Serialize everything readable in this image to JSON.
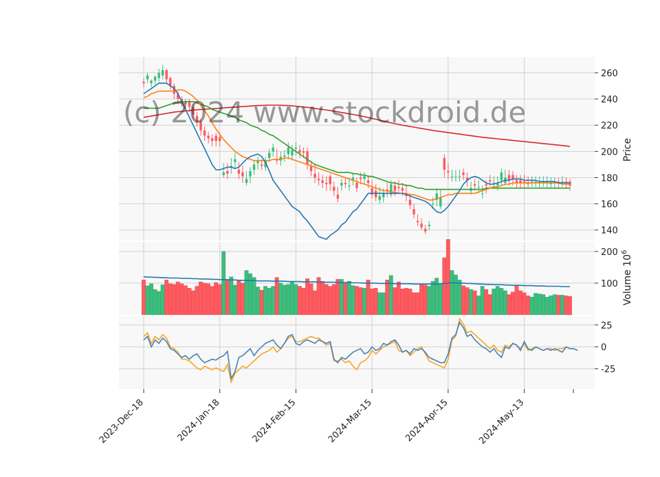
{
  "watermark": "(c) 2024 www.stockdroid.de",
  "colors": {
    "up": "#3dbd7d",
    "down": "#ff5a5f",
    "sma20": "#1f77b4",
    "sma50": "#ff7f0e",
    "sma100": "#2ca02c",
    "sma200": "#d62728",
    "vol_avg": "#1f77b4",
    "osc1": "#4682b4",
    "osc2": "#f5a623",
    "panel_bg": "#f8f8f8",
    "grid": "#d0d0d0"
  },
  "chart_data": [
    {
      "type": "candlestick",
      "ylabel": "Price",
      "ylim": [
        132,
        272
      ],
      "yticks": [
        140,
        160,
        180,
        200,
        220,
        240,
        260
      ],
      "x_tick_labels": [
        "2023-Dec-18",
        "2024-Jan-18",
        "2024-Feb-15",
        "2024-Mar-15",
        "2024-Apr-15",
        "2024-May-13"
      ],
      "x_tick_index": [
        0,
        20,
        40,
        60,
        80,
        100
      ],
      "open": [
        253,
        255,
        252,
        254,
        256,
        258,
        262,
        256,
        250,
        244,
        240,
        238,
        238,
        234,
        227,
        223,
        216,
        212,
        210,
        212,
        211,
        182,
        185,
        188,
        192,
        186,
        184,
        176,
        181,
        186,
        191,
        190,
        188,
        195,
        200,
        194,
        193,
        196,
        198,
        197,
        202,
        201,
        200,
        200,
        189,
        183,
        179,
        178,
        176,
        181,
        173,
        167,
        174,
        176,
        174,
        178,
        176,
        180,
        179,
        178,
        172,
        170,
        163,
        165,
        171,
        167,
        174,
        173,
        172,
        168,
        163,
        156,
        147,
        145,
        141,
        143,
        160,
        163,
        158,
        195,
        185,
        181,
        181,
        181,
        184,
        180,
        170,
        175,
        173,
        168,
        175,
        178,
        176,
        174,
        178,
        176,
        182,
        182,
        178,
        178,
        177,
        176,
        177,
        177,
        176,
        177,
        176,
        175,
        176,
        177,
        176,
        177,
        177
      ],
      "close": [
        252,
        258,
        254,
        257,
        260,
        262,
        255,
        250,
        244,
        240,
        238,
        236,
        234,
        228,
        222,
        216,
        212,
        210,
        208,
        208,
        208,
        184,
        183,
        189,
        194,
        183,
        181,
        179,
        185,
        190,
        193,
        189,
        193,
        199,
        203,
        193,
        196,
        197,
        203,
        201,
        203,
        199,
        199,
        190,
        185,
        180,
        178,
        176,
        175,
        175,
        170,
        164,
        176,
        175,
        174,
        180,
        172,
        179,
        181,
        176,
        167,
        165,
        166,
        168,
        170,
        175,
        170,
        172,
        170,
        166,
        159,
        152,
        146,
        142,
        139,
        144,
        160,
        168,
        165,
        186,
        184,
        181,
        181,
        181,
        182,
        178,
        172,
        174,
        173,
        168,
        174,
        177,
        176,
        176,
        184,
        180,
        178,
        179,
        176,
        176,
        176,
        175,
        177,
        177,
        176,
        177,
        177,
        176,
        176,
        176,
        177,
        176,
        174
      ],
      "high": [
        256,
        260,
        255,
        258,
        263,
        266,
        263,
        257,
        252,
        246,
        242,
        240,
        240,
        236,
        230,
        225,
        219,
        215,
        213,
        214,
        214,
        191,
        191,
        195,
        199,
        192,
        189,
        185,
        188,
        193,
        196,
        194,
        196,
        202,
        206,
        202,
        200,
        201,
        207,
        205,
        207,
        205,
        203,
        203,
        193,
        190,
        184,
        182,
        181,
        183,
        177,
        173,
        179,
        180,
        180,
        184,
        180,
        184,
        184,
        182,
        178,
        175,
        173,
        172,
        176,
        178,
        177,
        178,
        176,
        175,
        168,
        160,
        152,
        149,
        144,
        147,
        165,
        172,
        171,
        198,
        191,
        186,
        186,
        186,
        187,
        184,
        177,
        179,
        178,
        174,
        178,
        182,
        181,
        181,
        187,
        186,
        186,
        185,
        182,
        182,
        182,
        181,
        181,
        181,
        181,
        181,
        181,
        180,
        180,
        180,
        181,
        180,
        179
      ],
      "low": [
        249,
        252,
        249,
        251,
        253,
        255,
        252,
        247,
        240,
        236,
        234,
        232,
        230,
        225,
        219,
        212,
        208,
        206,
        204,
        204,
        204,
        180,
        179,
        183,
        187,
        179,
        176,
        174,
        176,
        182,
        186,
        186,
        185,
        192,
        196,
        190,
        189,
        192,
        194,
        193,
        197,
        195,
        195,
        186,
        181,
        176,
        174,
        172,
        170,
        170,
        166,
        161,
        170,
        172,
        170,
        174,
        169,
        175,
        175,
        172,
        164,
        162,
        160,
        161,
        165,
        165,
        166,
        168,
        166,
        162,
        156,
        149,
        143,
        140,
        137,
        140,
        156,
        158,
        156,
        180,
        179,
        177,
        177,
        177,
        178,
        173,
        167,
        170,
        168,
        164,
        168,
        173,
        172,
        170,
        174,
        174,
        174,
        174,
        172,
        172,
        172,
        172,
        173,
        173,
        172,
        173,
        172,
        172,
        172,
        172,
        173,
        172,
        170
      ],
      "sma20": [
        244,
        246,
        248,
        250,
        252,
        252,
        252,
        250,
        248,
        244,
        238,
        232,
        226,
        220,
        214,
        208,
        202,
        196,
        190,
        186,
        186,
        187,
        188,
        188,
        187,
        188,
        191,
        194,
        196,
        197,
        198,
        196,
        192,
        185,
        178,
        174,
        170,
        166,
        162,
        158,
        156,
        154,
        150,
        147,
        143,
        139,
        135,
        134,
        133,
        136,
        138,
        140,
        144,
        146,
        150,
        154,
        156,
        160,
        164,
        168,
        168,
        168,
        168,
        168,
        168,
        168,
        168,
        168,
        168,
        167,
        166,
        165,
        164,
        163,
        162,
        160,
        157,
        154,
        153,
        155,
        158,
        162,
        166,
        170,
        175,
        178,
        180,
        181,
        180,
        178,
        176,
        175,
        175,
        176,
        177,
        178,
        178,
        179,
        179,
        179,
        178,
        178,
        178,
        178,
        177,
        177,
        177,
        177,
        177,
        176,
        176,
        176,
        176
      ],
      "sma50": [
        241,
        242,
        244,
        245,
        246,
        246,
        246,
        246,
        246,
        247,
        247,
        246,
        244,
        242,
        239,
        235,
        231,
        227,
        222,
        217,
        213,
        209,
        206,
        203,
        200,
        198,
        196,
        195,
        194,
        193,
        193,
        193,
        193,
        193,
        194,
        194,
        194,
        195,
        195,
        194,
        193,
        192,
        191,
        190,
        189,
        188,
        187,
        186,
        185,
        184,
        183,
        182,
        181,
        180,
        179,
        178,
        177,
        176,
        175,
        174,
        173,
        172,
        171,
        170,
        170,
        169,
        169,
        168,
        168,
        168,
        167,
        167,
        166,
        165,
        164,
        163,
        163,
        164,
        165,
        166,
        167,
        167,
        168,
        168,
        168,
        168,
        168,
        168,
        169,
        170,
        171,
        172,
        173,
        173,
        174,
        175,
        175,
        176,
        176,
        176,
        176,
        176,
        176,
        176,
        176,
        176,
        176,
        176,
        176,
        176,
        175,
        175,
        175
      ],
      "sma100": [
        233,
        233,
        233,
        233,
        233,
        234,
        235,
        236,
        237,
        237,
        238,
        238,
        238,
        238,
        237,
        236,
        235,
        234,
        232,
        231,
        230,
        229,
        228,
        227,
        226,
        224,
        223,
        222,
        220,
        219,
        218,
        216,
        215,
        213,
        212,
        210,
        208,
        206,
        204,
        202,
        200,
        198,
        196,
        194,
        192,
        190,
        189,
        188,
        187,
        186,
        185,
        184,
        184,
        184,
        184,
        183,
        183,
        182,
        182,
        181,
        181,
        180,
        179,
        178,
        177,
        176,
        176,
        175,
        175,
        174,
        174,
        173,
        172,
        172,
        171,
        171,
        171,
        171,
        171,
        171,
        171,
        171,
        171,
        171,
        171,
        171,
        171,
        171,
        171,
        171,
        172,
        172,
        172,
        172,
        172,
        172,
        172,
        172,
        172,
        172,
        172,
        172,
        172,
        172,
        172,
        172,
        172,
        172,
        172,
        172,
        172,
        172,
        172
      ],
      "sma200": [
        226,
        226.5,
        227,
        227.5,
        228,
        228.5,
        229,
        229.5,
        230,
        230.3,
        230.6,
        230.9,
        231.2,
        231.5,
        231.8,
        232,
        232.2,
        232.4,
        232.6,
        232.8,
        233,
        233.2,
        233.4,
        233.6,
        233.8,
        234,
        234.2,
        234.4,
        234.6,
        234.8,
        235,
        235.1,
        235.2,
        235.3,
        235.3,
        235.3,
        235.2,
        235.1,
        235,
        234.8,
        234.5,
        234.2,
        233.9,
        233.6,
        233.2,
        232.8,
        232.4,
        232,
        231.6,
        231.2,
        230.7,
        230.2,
        229.7,
        229.2,
        228.7,
        228.2,
        227.7,
        227.1,
        226.5,
        225.9,
        225.2,
        224.5,
        223.8,
        223.1,
        222.4,
        221.8,
        221.2,
        220.6,
        220,
        219.5,
        219,
        218.5,
        218,
        217.5,
        217,
        216.5,
        216,
        215.6,
        215.2,
        214.8,
        214.4,
        214,
        213.6,
        213.2,
        212.8,
        212.4,
        212,
        211.6,
        211.2,
        210.8,
        210.5,
        210.2,
        209.9,
        209.6,
        209.3,
        209,
        208.7,
        208.4,
        208.1,
        207.8,
        207.5,
        207.2,
        206.9,
        206.6,
        206.3,
        206,
        205.7,
        205.4,
        205.1,
        204.8,
        204.5,
        204.2,
        203.9
      ]
    },
    {
      "type": "bar",
      "ylabel": "Volume  10^6",
      "ylim": [
        0,
        230
      ],
      "yticks": [
        100,
        200
      ],
      "values": [
        110,
        92,
        98,
        80,
        74,
        95,
        110,
        98,
        96,
        104,
        98,
        92,
        84,
        76,
        90,
        104,
        100,
        98,
        90,
        102,
        96,
        200,
        110,
        120,
        94,
        110,
        100,
        140,
        130,
        118,
        88,
        78,
        90,
        84,
        90,
        118,
        100,
        94,
        96,
        104,
        96,
        90,
        84,
        114,
        98,
        76,
        118,
        106,
        96,
        90,
        96,
        112,
        112,
        100,
        106,
        92,
        90,
        86,
        84,
        110,
        82,
        84,
        70,
        70,
        110,
        124,
        86,
        104,
        82,
        84,
        82,
        70,
        70,
        98,
        94,
        90,
        106,
        116,
        98,
        180,
        238,
        140,
        126,
        110,
        92,
        86,
        80,
        76,
        60,
        90,
        80,
        64,
        82,
        90,
        84,
        76,
        64,
        72,
        94,
        76,
        70,
        60,
        56,
        68,
        66,
        64,
        56,
        60,
        64,
        62,
        62,
        60,
        58
      ],
      "avg": [
        120,
        119,
        119,
        118,
        118,
        117,
        117,
        116,
        116,
        116,
        115,
        115,
        115,
        114,
        114,
        113,
        113,
        113,
        112,
        112,
        111,
        111,
        111,
        110,
        110,
        109,
        109,
        108,
        108,
        108,
        107,
        107,
        107,
        107,
        106,
        106,
        106,
        106,
        105,
        105,
        105,
        105,
        104,
        104,
        104,
        104,
        103,
        103,
        103,
        103,
        103,
        102,
        102,
        102,
        102,
        101,
        101,
        101,
        100,
        100,
        100,
        100,
        99,
        99,
        99,
        99,
        98,
        98,
        98,
        98,
        98,
        97,
        97,
        97,
        97,
        97,
        97,
        97,
        98,
        99,
        100,
        101,
        101,
        100,
        100,
        99,
        99,
        98,
        97,
        97,
        96,
        96,
        95,
        95,
        95,
        94,
        94,
        93,
        93,
        93,
        92,
        92,
        92,
        91,
        91,
        91,
        90,
        90,
        90,
        90,
        89,
        89,
        89
      ]
    },
    {
      "type": "line",
      "ylim": [
        -48,
        35
      ],
      "yticks": [
        -25,
        0,
        25
      ],
      "series": [
        {
          "values": [
            8,
            12,
            0,
            8,
            4,
            10,
            6,
            -2,
            -4,
            -8,
            -12,
            -10,
            -14,
            -10,
            -8,
            -14,
            -18,
            -16,
            -14,
            -15,
            -12,
            -10,
            -5,
            -36,
            -28,
            -12,
            -10,
            -6,
            -2,
            -10,
            -4,
            0,
            4,
            6,
            8,
            2,
            -2,
            4,
            12,
            14,
            4,
            2,
            6,
            8,
            6,
            4,
            8,
            6,
            4,
            6,
            -14,
            -18,
            -12,
            -14,
            -10,
            -6,
            -4,
            -2,
            -8,
            -6,
            0,
            -4,
            -2,
            4,
            2,
            6,
            8,
            2,
            -6,
            -4,
            -8,
            -2,
            -4,
            -2,
            -6,
            -12,
            -14,
            -16,
            -18,
            -18,
            -8,
            10,
            14,
            28,
            22,
            12,
            14,
            8,
            4,
            0,
            -2,
            -6,
            -2,
            -8,
            -12,
            0,
            -2,
            4,
            2,
            -4,
            6,
            -2,
            -4,
            0,
            -2,
            -4,
            -2,
            -4,
            -2,
            -4,
            -6,
            0,
            -2,
            -2,
            -4
          ]
        },
        {
          "values": [
            12,
            16,
            4,
            12,
            8,
            14,
            10,
            0,
            -2,
            -6,
            -14,
            -14,
            -16,
            -20,
            -24,
            -26,
            -22,
            -24,
            -26,
            -24,
            -26,
            -28,
            -20,
            -40,
            -30,
            -26,
            -22,
            -24,
            -20,
            -16,
            -12,
            -8,
            -6,
            -4,
            0,
            -6,
            -2,
            4,
            10,
            12,
            6,
            6,
            8,
            10,
            12,
            10,
            10,
            6,
            2,
            4,
            -16,
            -16,
            -14,
            -18,
            -16,
            -22,
            -26,
            -18,
            -16,
            -12,
            -4,
            -8,
            -4,
            0,
            2,
            4,
            6,
            -4,
            -6,
            -4,
            -10,
            -6,
            -2,
            0,
            -8,
            -16,
            -18,
            -20,
            -22,
            -24,
            -14,
            8,
            12,
            32,
            26,
            16,
            18,
            14,
            10,
            6,
            2,
            -2,
            2,
            -4,
            -6,
            2,
            0,
            4,
            2,
            -2,
            4,
            -4,
            -2,
            0,
            -2,
            -4,
            -2,
            -2,
            -4,
            -2,
            -2,
            0,
            -2,
            -2,
            -4
          ]
        }
      ]
    }
  ]
}
